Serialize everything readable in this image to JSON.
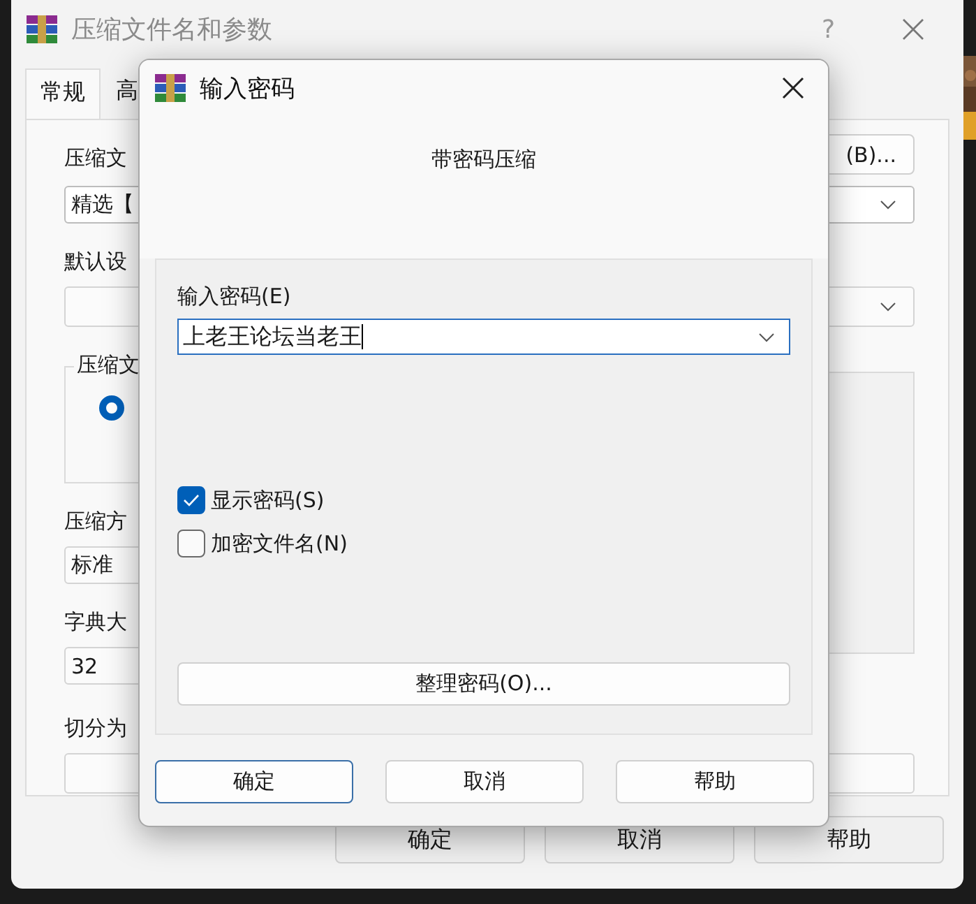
{
  "main_window": {
    "title": "压缩文件名和参数",
    "help_glyph": "?",
    "tabs": [
      {
        "label": "常规",
        "selected": true
      },
      {
        "label": "高",
        "selected": false
      }
    ],
    "archive_name_label": "压缩文",
    "browse_button": "(B)...",
    "archive_name_value": "精选【",
    "profile_label": "默认设",
    "format_group": {
      "label": "压缩文",
      "options": [
        {
          "selected": true
        }
      ]
    },
    "method_label": "压缩方",
    "method_value": "标准",
    "dict_label": "字典大",
    "dict_value": "32",
    "split_label": "切分为",
    "buttons": [
      "确定",
      "取消",
      "帮助"
    ]
  },
  "dialog": {
    "title": "输入密码",
    "heading": "带密码压缩",
    "password_label": "输入密码(E)",
    "password_value": "上老王论坛当老王",
    "options": [
      {
        "label": "显示密码(S)",
        "checked": true
      },
      {
        "label": "加密文件名(N)",
        "checked": false
      }
    ],
    "organize_button": "整理密码(O)...",
    "buttons": [
      {
        "label": "确定",
        "default": true
      },
      {
        "label": "取消",
        "default": false
      },
      {
        "label": "帮助",
        "default": false
      }
    ]
  }
}
